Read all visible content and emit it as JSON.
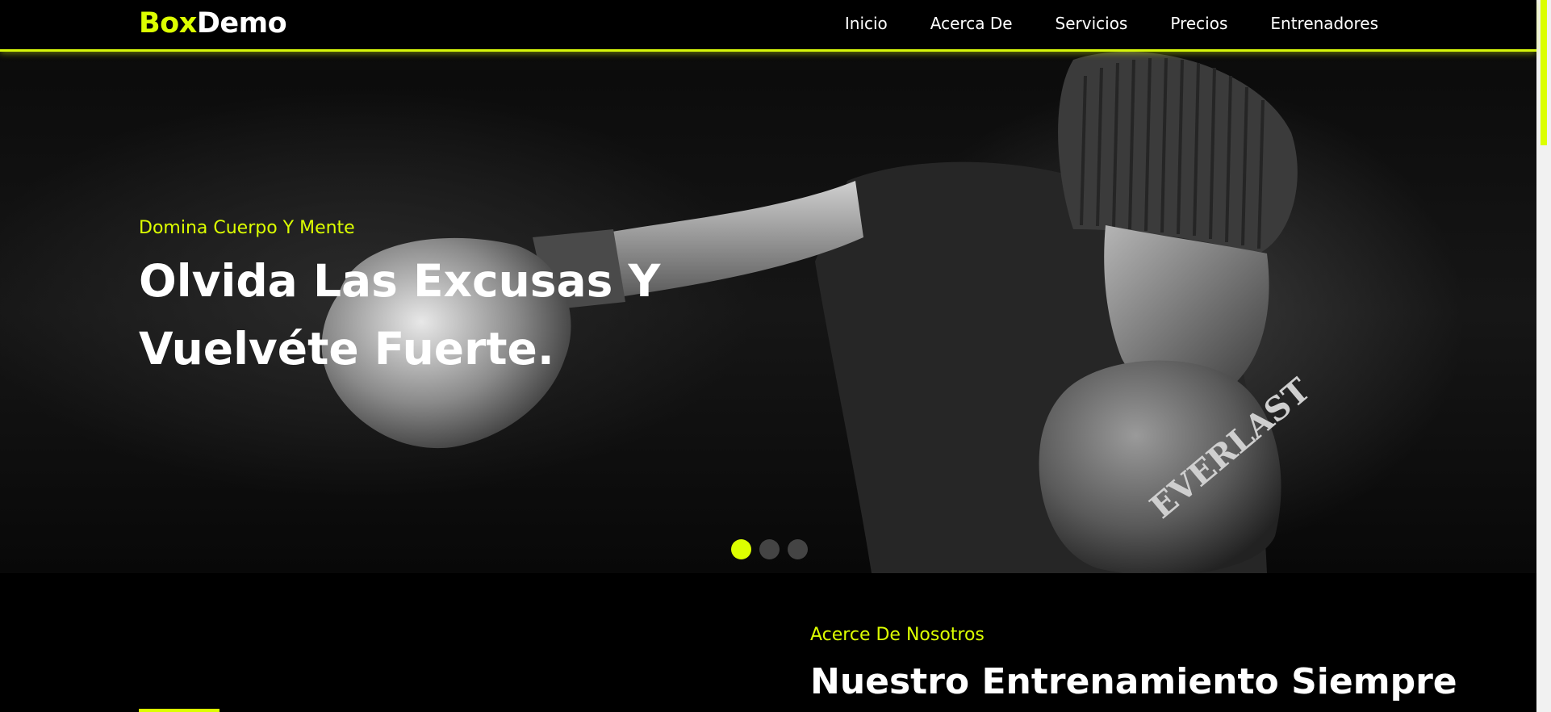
{
  "brand": {
    "part1": "Box",
    "part2": "Demo",
    "accent_color": "#dcff00"
  },
  "nav": [
    {
      "label": "Inicio"
    },
    {
      "label": "Acerca De"
    },
    {
      "label": "Servicios"
    },
    {
      "label": "Precios"
    },
    {
      "label": "Entrenadores"
    }
  ],
  "hero": {
    "subtitle": "Domina Cuerpo Y Mente",
    "title": "Olvida Las Excusas Y Vuelvéte Fuerte.",
    "slides_count": 3,
    "active_slide": 1
  },
  "about": {
    "subtitle": "Acerce De Nosotros",
    "title": "Nuestro Entrenamiento Siempre"
  },
  "colors": {
    "background": "#000000",
    "accent": "#dcff00",
    "text": "#ffffff"
  }
}
